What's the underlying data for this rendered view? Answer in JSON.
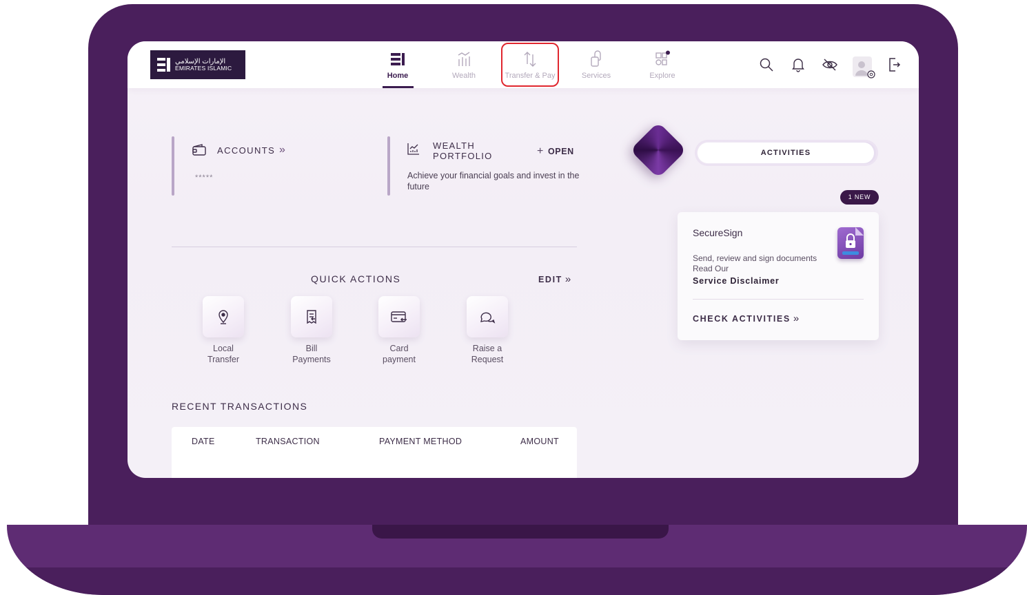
{
  "brand": {
    "arabic_name": "الإمارات الإسلامي",
    "english_name": "EMIRATES ISLAMIC",
    "colors": {
      "primary": "#3b1c4f",
      "laptop": "#4a1f5c",
      "highlight": "#e0262e"
    }
  },
  "nav": {
    "items": [
      {
        "label": "Home",
        "icon": "home-icon",
        "active": true
      },
      {
        "label": "Wealth",
        "icon": "wealth-chart-icon",
        "active": false
      },
      {
        "label": "Transfer & Pay",
        "icon": "transfer-arrows-icon",
        "active": false,
        "highlighted": true
      },
      {
        "label": "Services",
        "icon": "services-icon",
        "active": false
      },
      {
        "label": "Explore",
        "icon": "explore-grid-icon",
        "active": false
      }
    ]
  },
  "header_actions": {
    "icons": [
      "search-icon",
      "bell-icon",
      "eye-off-icon",
      "profile-settings-icon",
      "logout-icon"
    ]
  },
  "accounts": {
    "label": "ACCOUNTS",
    "chevron": "»",
    "masked_balance": "*****"
  },
  "wealth": {
    "title": "WEALTH PORTFOLIO",
    "action_label": "OPEN",
    "action_plus": "+",
    "description": "Achieve your financial goals and invest in the future"
  },
  "quick_actions": {
    "title": "QUICK ACTIONS",
    "edit_label": "EDIT",
    "chevron": "»",
    "items": [
      {
        "label_line1": "Local",
        "label_line2": "Transfer",
        "icon": "location-pin-icon"
      },
      {
        "label_line1": "Bill",
        "label_line2": "Payments",
        "icon": "bill-icon"
      },
      {
        "label_line1": "Card",
        "label_line2": "payment",
        "icon": "card-icon"
      },
      {
        "label_line1": "Raise a",
        "label_line2": "Request",
        "icon": "chat-bubbles-icon"
      }
    ]
  },
  "recent_transactions": {
    "title": "RECENT TRANSACTIONS",
    "columns": [
      "DATE",
      "TRANSACTION",
      "PAYMENT METHOD",
      "AMOUNT"
    ]
  },
  "activities": {
    "tab_label": "ACTIVITIES",
    "badge": "1 NEW",
    "card": {
      "title": "SecureSign",
      "desc_line1": "Send, review and sign documents",
      "desc_line2": "Read Our",
      "link": "Service Disclaimer",
      "cta": "CHECK ACTIVITIES",
      "chevron": "»",
      "icon": "lock-document-icon"
    }
  }
}
